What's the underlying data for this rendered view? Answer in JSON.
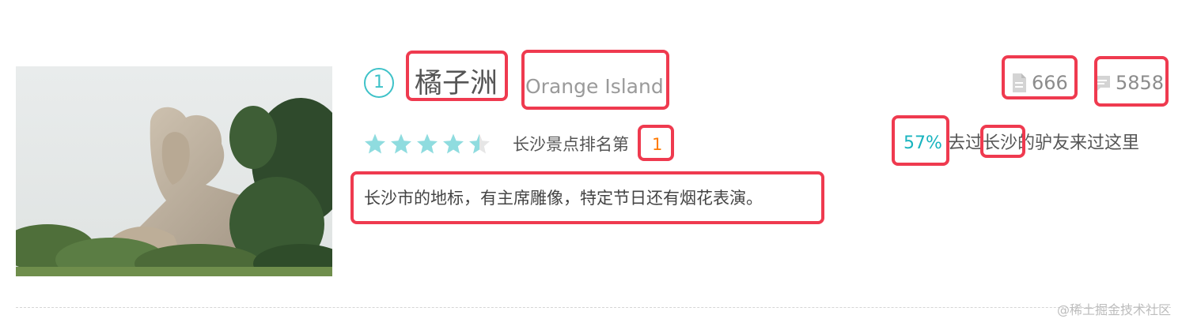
{
  "spot": {
    "rank": "1",
    "name_cn": "橘子洲",
    "name_en": "Orange Island",
    "notes_count": "666",
    "comments_count": "5858",
    "rating": 4.5,
    "rating_max": 5,
    "ranking_text": "长沙景点排名第",
    "ranking_number": "1",
    "visited_percent": "57%",
    "visited_text": "去过长沙的驴友来过这里",
    "description": "长沙市的地标，有主席雕像，特定节日还有烟花表演。"
  },
  "footer": {
    "watermark": "@稀土掘金技术社区"
  },
  "colors": {
    "accent": "#3ec2c8",
    "rank_highlight": "#ff7a00",
    "annotation_box": "#ef3a4f",
    "star": "#8fdcdf"
  },
  "icons": {
    "notes": "document-icon",
    "comments": "comment-icon"
  }
}
